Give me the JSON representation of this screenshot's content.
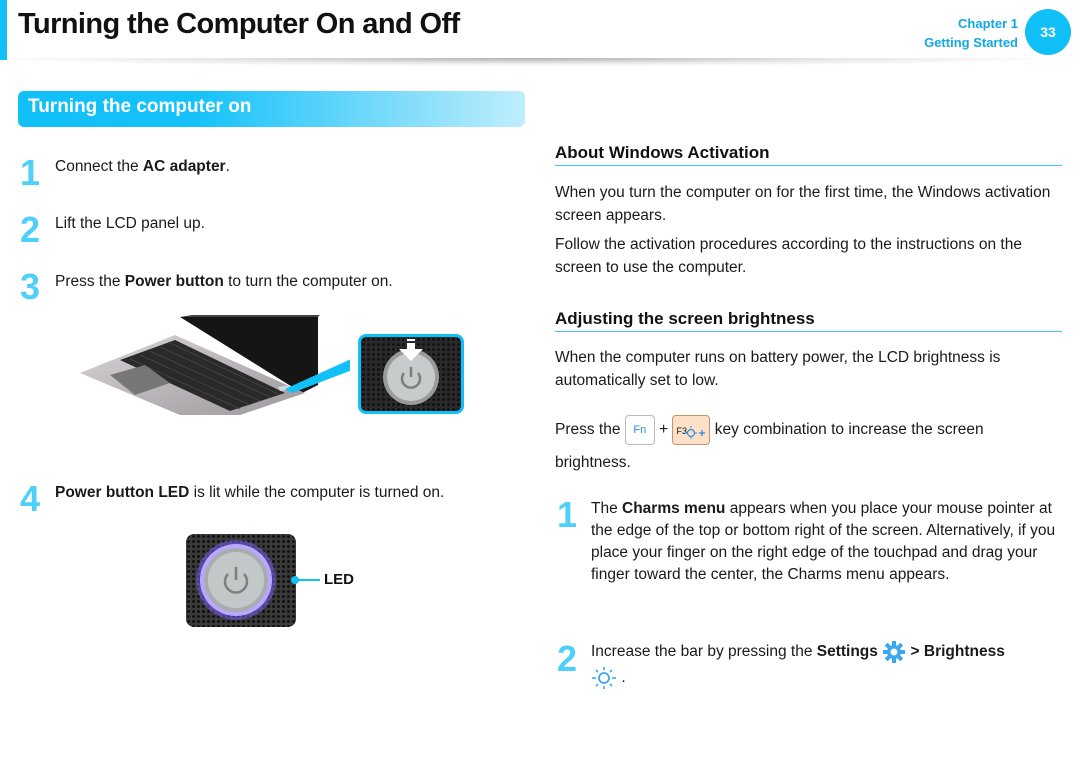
{
  "header": {
    "title": "Turning the Computer On and Off",
    "chapter_label": "Chapter 1",
    "chapter_name": "Getting Started",
    "page_number": "33",
    "accent_color": "#12c0f8"
  },
  "left_section": {
    "banner": "Turning the computer on",
    "steps": [
      {
        "num": "1",
        "pre": "Connect the ",
        "bold": "AC adapter",
        "post": "."
      },
      {
        "num": "2",
        "pre": "Lift the LCD panel up.",
        "bold": "",
        "post": ""
      },
      {
        "num": "3",
        "pre": "Press the ",
        "bold": "Power button",
        "post": " to turn the computer on."
      },
      {
        "num": "4",
        "pre": "",
        "bold": "Power button LED",
        "post": " is lit while the computer is turned on."
      }
    ],
    "images": {
      "laptop": "laptop-illustration",
      "power_button_closeup": "power-button-closeup",
      "led_closeup": "power-button-led-closeup"
    },
    "led_label": "LED"
  },
  "right_section": {
    "activation": {
      "heading": "About Windows Activation",
      "paragraphs": [
        "When you turn the computer on for the first time, the Windows activation screen appears.",
        "Follow the activation procedures according to the instructions on the screen to use the computer."
      ]
    },
    "brightness": {
      "heading": "Adjusting the screen brightness",
      "paragraph": "When the computer runs on battery power, the LCD brightness is automatically set to low.",
      "press_pre": "Press the",
      "plus": "+",
      "press_post": "key combination to increase the screen",
      "press_end": "brightness.",
      "key_fn": "Fn",
      "key_f3": "F3",
      "steps": [
        {
          "num": "1",
          "pre": "The ",
          "bold": "Charms menu",
          "post": " appears when you place your mouse pointer at the edge of the top or bottom right of the screen. Alternatively, if you place your finger on the right edge of the touchpad and drag your finger toward the center, the Charms menu appears."
        },
        {
          "num": "2",
          "pre": "Increase the bar by pressing the ",
          "bold": "Settings",
          "bold2": "> Brightness",
          "post": "."
        }
      ]
    }
  }
}
